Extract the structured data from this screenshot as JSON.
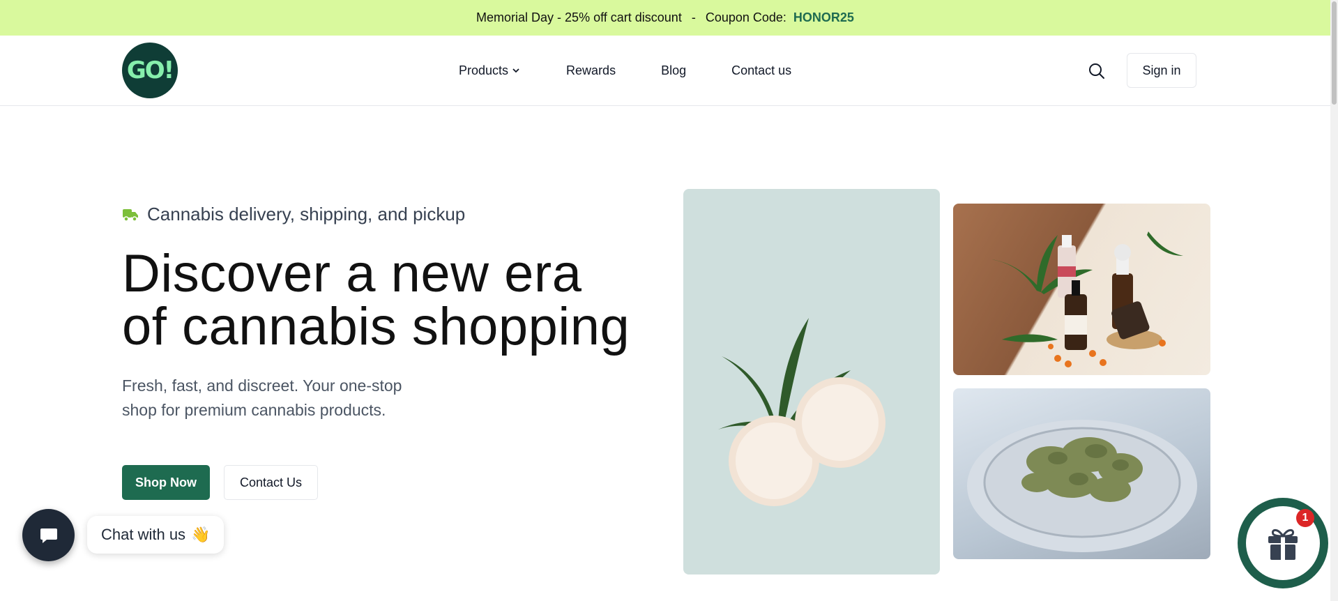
{
  "announcement": {
    "text": "Memorial Day - 25% off cart discount",
    "separator": "-",
    "coupon_label": "Coupon Code:",
    "coupon_code": "HONOR25"
  },
  "header": {
    "logo_text": "GO!",
    "nav": [
      {
        "label": "Products"
      },
      {
        "label": "Rewards"
      },
      {
        "label": "Blog"
      },
      {
        "label": "Contact us"
      }
    ],
    "signin_label": "Sign in"
  },
  "hero": {
    "tagline": "Cannabis delivery, shipping, and pickup",
    "headline_line1": "Discover a new era",
    "headline_line2": "of cannabis shopping",
    "subtext": "Fresh, fast, and discreet. Your one-stop shop for premium cannabis products.",
    "primary_button": "Shop Now",
    "secondary_button": "Contact Us"
  },
  "chat": {
    "label": "Chat with us",
    "emoji": "👋"
  },
  "gift": {
    "badge_count": "1"
  },
  "colors": {
    "announce_bg": "#d9f99d",
    "brand_green": "#1e6b50",
    "logo_bg": "#0f3d36"
  }
}
